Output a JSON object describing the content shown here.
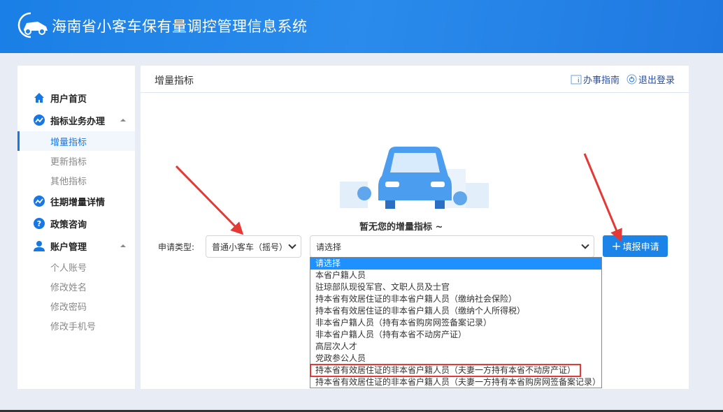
{
  "header": {
    "title": "海南省小客车保有量调控管理信息系统"
  },
  "sidebar": {
    "items": [
      {
        "label": "用户首页",
        "icon": "home-icon"
      },
      {
        "label": "指标业务办理",
        "icon": "trend-icon"
      },
      {
        "label": "增量指标"
      },
      {
        "label": "更新指标"
      },
      {
        "label": "其他指标"
      },
      {
        "label": "往期增量详情",
        "icon": "trend-icon"
      },
      {
        "label": "政策咨询",
        "icon": "question-icon"
      },
      {
        "label": "账户管理",
        "icon": "user-icon"
      },
      {
        "label": "个人账号"
      },
      {
        "label": "修改姓名"
      },
      {
        "label": "修改密码"
      },
      {
        "label": "修改手机号"
      }
    ]
  },
  "main": {
    "title": "增量指标",
    "guide": "办事指南",
    "logout": "退出登录",
    "empty_text": "暂无您的增量指标 ~",
    "type_label": "申请类型:",
    "type_value": "普通小客车（摇号）",
    "category_value": "请选择",
    "submit": "填报申请",
    "options": [
      "请选择",
      "本省户籍人员",
      "驻琼部队现役军官、文职人员及士官",
      "持本省有效居住证的非本省户籍人员（缴纳社会保险）",
      "持本省有效居住证的非本省户籍人员（缴纳个人所得税）",
      "非本省户籍人员（持有本省购房网签备案记录）",
      "非本省户籍人员（持有本省不动房产证）",
      "高层次人才",
      "党政参公人员",
      "持本省有效居住证的非本省户籍人员（夫妻一方持有本省不动房产证）",
      "持本省有效居住证的非本省户籍人员（夫妻一方持有本省购房网签备案记录）"
    ]
  },
  "colors": {
    "accent": "#1a84e8",
    "highlight": "#e53935"
  }
}
